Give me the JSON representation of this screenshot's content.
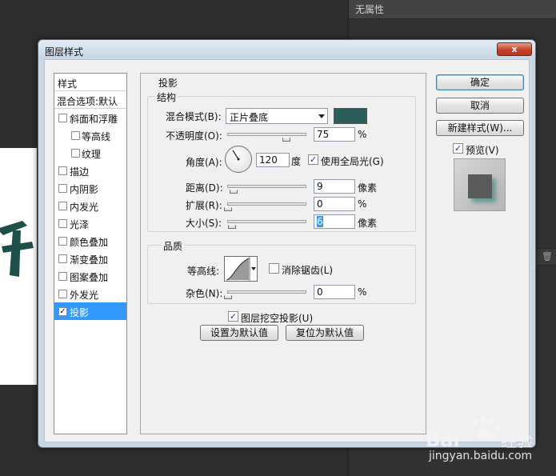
{
  "background": {
    "panel_title": "无属性",
    "watermark": "jingyan.baidu.com",
    "doc_glyph_color": "#1f4f4a"
  },
  "dialog": {
    "title": "图层样式",
    "close_label": "x"
  },
  "style_list": {
    "header": "样式",
    "blend_options": "混合选项:默认",
    "items": [
      {
        "label": "斜面和浮雕",
        "checked": false
      },
      {
        "label": "等高线",
        "checked": false
      },
      {
        "label": "纹理",
        "checked": false
      },
      {
        "label": "描边",
        "checked": false
      },
      {
        "label": "内阴影",
        "checked": false
      },
      {
        "label": "内发光",
        "checked": false
      },
      {
        "label": "光泽",
        "checked": false
      },
      {
        "label": "颜色叠加",
        "checked": false
      },
      {
        "label": "渐变叠加",
        "checked": false
      },
      {
        "label": "图案叠加",
        "checked": false
      },
      {
        "label": "外发光",
        "checked": false
      },
      {
        "label": "投影",
        "checked": true
      }
    ]
  },
  "drop_shadow": {
    "section_title": "投影",
    "structure_title": "结构",
    "blend_mode_label": "混合模式(B):",
    "blend_mode_value": "正片叠底",
    "shadow_color": "#2b5e58",
    "opacity_label": "不透明度(O):",
    "opacity_value": "75",
    "opacity_unit": "%",
    "angle_label": "角度(A):",
    "angle_value": "120",
    "angle_unit": "度",
    "global_light_label": "使用全局光(G)",
    "global_light_checked": true,
    "distance_label": "距离(D):",
    "distance_value": "9",
    "distance_unit": "像素",
    "spread_label": "扩展(R):",
    "spread_value": "0",
    "spread_unit": "%",
    "size_label": "大小(S):",
    "size_value": "6",
    "size_unit": "像素",
    "quality_title": "品质",
    "contour_label": "等高线:",
    "anti_alias_label": "消除锯齿(L)",
    "anti_alias_checked": false,
    "noise_label": "杂色(N):",
    "noise_value": "0",
    "noise_unit": "%",
    "knockout_label": "图层挖空投影(U)",
    "knockout_checked": true,
    "make_default_label": "设置为默认值",
    "reset_default_label": "复位为默认值"
  },
  "actions": {
    "ok_label": "确定",
    "cancel_label": "取消",
    "new_style_label": "新建样式(W)...",
    "preview_label": "预览(V)",
    "preview_checked": true
  }
}
